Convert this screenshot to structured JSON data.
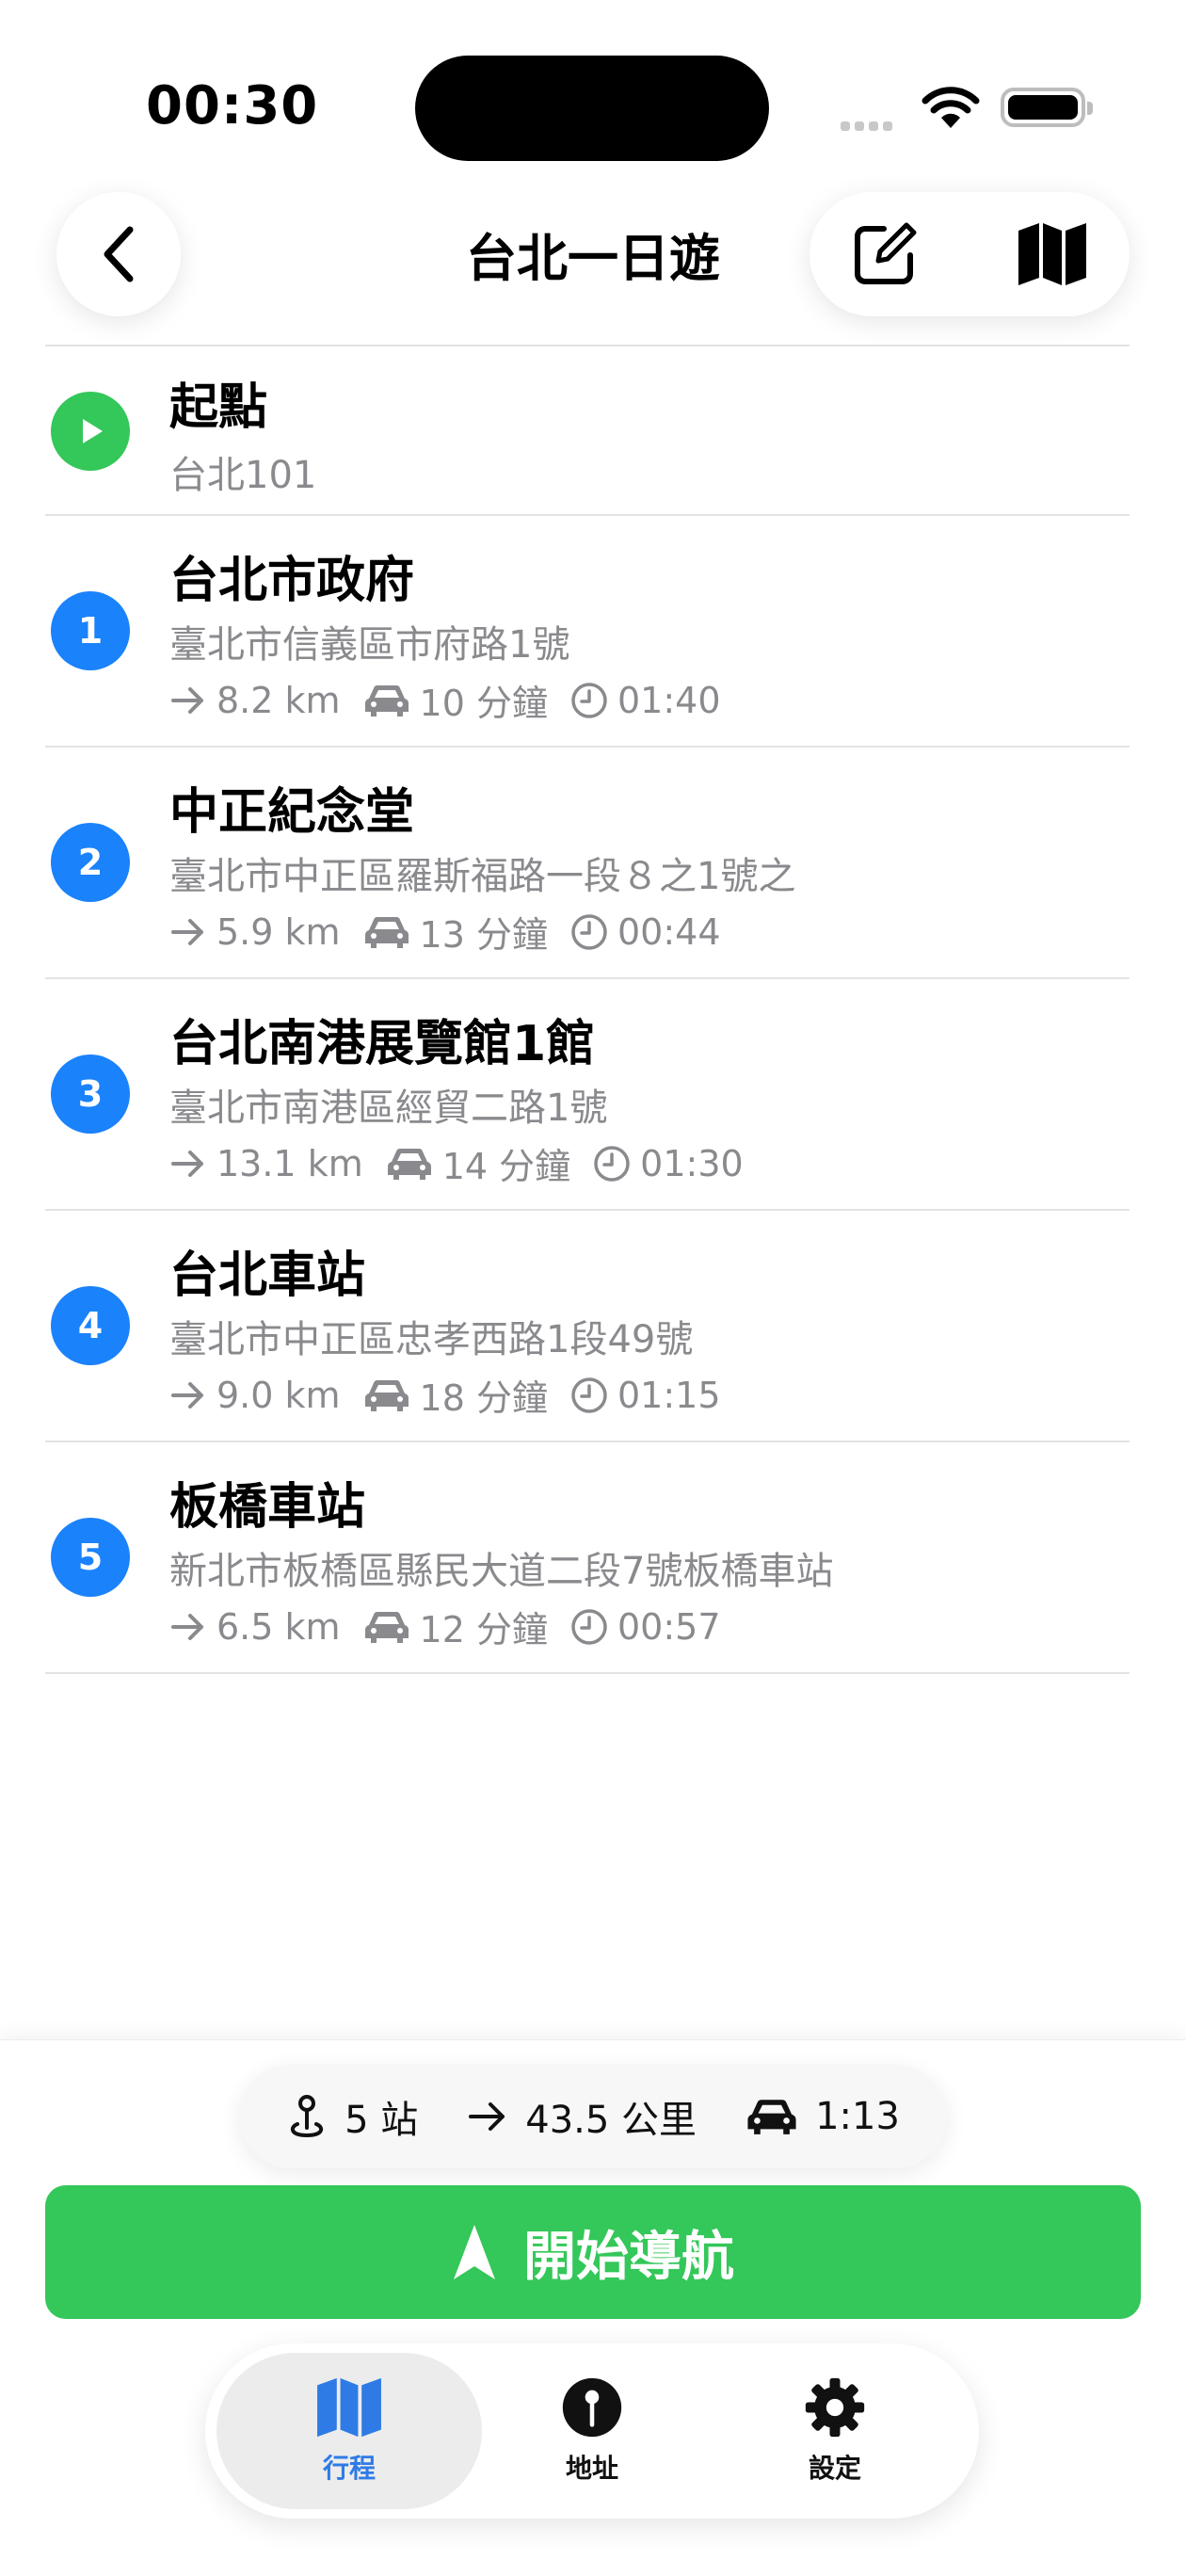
{
  "status_bar": {
    "time": "00:30"
  },
  "header": {
    "title": "台北一日遊"
  },
  "start": {
    "label": "起點",
    "address": "台北101"
  },
  "stops": [
    {
      "number": "1",
      "name": "台北市政府",
      "address": "臺北市信義區市府路1號",
      "distance": "8.2 km",
      "drive_time": "10 分鐘",
      "clock": "01:40"
    },
    {
      "number": "2",
      "name": "中正紀念堂",
      "address": "臺北市中正區羅斯福路一段８之1號之",
      "distance": "5.9 km",
      "drive_time": "13 分鐘",
      "clock": "00:44"
    },
    {
      "number": "3",
      "name": "台北南港展覽館1館",
      "address": "臺北市南港區經貿二路1號",
      "distance": "13.1 km",
      "drive_time": "14 分鐘",
      "clock": "01:30"
    },
    {
      "number": "4",
      "name": "台北車站",
      "address": "臺北市中正區忠孝西路1段49號",
      "distance": "9.0 km",
      "drive_time": "18 分鐘",
      "clock": "01:15"
    },
    {
      "number": "5",
      "name": "板橋車站",
      "address": "新北市板橋區縣民大道二段7號板橋車站",
      "distance": "6.5 km",
      "drive_time": "12 分鐘",
      "clock": "00:57"
    }
  ],
  "summary": {
    "stops": "5 站",
    "distance": "43.5 公里",
    "duration": "1:13"
  },
  "nav_button": {
    "label": "開始導航"
  },
  "tabs": [
    {
      "label": "行程",
      "icon": "map-icon",
      "active": true
    },
    {
      "label": "地址",
      "icon": "pin-icon",
      "active": false
    },
    {
      "label": "設定",
      "icon": "gear-icon",
      "active": false
    }
  ],
  "colors": {
    "accent_blue": "#1a82fb",
    "start_green": "#34c759",
    "nav_green": "#34c759",
    "secondary_text": "#8a8a8e",
    "tab_active": "#2f7be6"
  }
}
